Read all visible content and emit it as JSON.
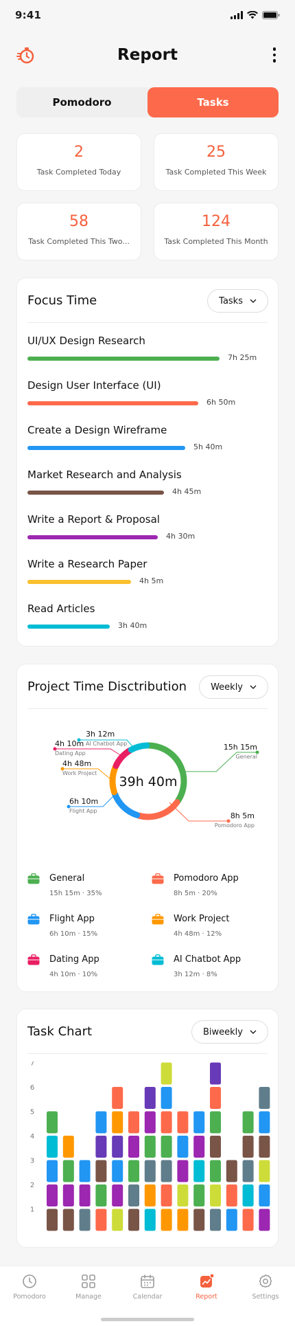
{
  "status": {
    "time": "9:41"
  },
  "header": {
    "title": "Report"
  },
  "segments": [
    {
      "label": "Pomodoro",
      "active": false
    },
    {
      "label": "Tasks",
      "active": true
    }
  ],
  "stats": [
    {
      "value": "2",
      "label": "Task Completed Today"
    },
    {
      "value": "25",
      "label": "Task Completed This Week"
    },
    {
      "value": "58",
      "label": "Task Completed This Two..."
    },
    {
      "value": "124",
      "label": "Task Completed This Month"
    }
  ],
  "focus": {
    "title": "Focus Time",
    "dropdown": "Tasks",
    "items": [
      {
        "name": "UI/UX Design Research",
        "time": "7h 25m",
        "color": "#4caf50",
        "fraction": 1.0
      },
      {
        "name": "Design User Interface (UI)",
        "time": "6h 50m",
        "color": "#fd6a4b",
        "fraction": 0.89
      },
      {
        "name": "Create a Design Wireframe",
        "time": "5h 40m",
        "color": "#2196f3",
        "fraction": 0.82
      },
      {
        "name": "Market Research and Analysis",
        "time": "4h 45m",
        "color": "#795548",
        "fraction": 0.71
      },
      {
        "name": "Write a Report & Proposal",
        "time": "4h 30m",
        "color": "#9c27b0",
        "fraction": 0.68
      },
      {
        "name": "Write a Research Paper",
        "time": "4h 5m",
        "color": "#fbc02d",
        "fraction": 0.54
      },
      {
        "name": "Read Articles",
        "time": "3h 40m",
        "color": "#00bcd4",
        "fraction": 0.43
      }
    ]
  },
  "distribution": {
    "title": "Project Time Disctribution",
    "dropdown": "Weekly",
    "total": "39h 40m",
    "segments": [
      {
        "name": "General",
        "time": "15h 15m",
        "percent": "35%",
        "pct": 35,
        "color": "#4caf50"
      },
      {
        "name": "Pomodoro App",
        "time": "8h 5m",
        "percent": "20%",
        "pct": 20,
        "color": "#fd6a4b"
      },
      {
        "name": "Flight App",
        "time": "6h 10m",
        "percent": "15%",
        "pct": 15,
        "color": "#2196f3"
      },
      {
        "name": "Work Project",
        "time": "4h 48m",
        "percent": "12%",
        "pct": 12,
        "color": "#ff9800"
      },
      {
        "name": "Dating App",
        "time": "4h 10m",
        "percent": "10%",
        "pct": 10,
        "color": "#e91e63"
      },
      {
        "name": "AI Chatbot App",
        "time": "3h 12m",
        "percent": "8%",
        "pct": 8,
        "color": "#00bcd4"
      }
    ],
    "legend_order": [
      "General",
      "Pomodoro App",
      "Flight App",
      "Work Project",
      "Dating App",
      "AI Chatbot App"
    ]
  },
  "task_chart": {
    "title": "Task Chart",
    "dropdown": "Biweekly",
    "y_ticks": [
      "7",
      "6",
      "5",
      "4",
      "3",
      "2",
      "1"
    ]
  },
  "chart_data": {
    "type": "bar",
    "title": "Task Chart",
    "ylim": [
      0,
      7
    ],
    "stacked": true,
    "columns": [
      [
        "#795548",
        "#9c27b0",
        "#2196f3",
        "#00bcd4",
        "#4caf50"
      ],
      [
        "#795548",
        "#9c27b0",
        "#4caf50",
        "#ff9800"
      ],
      [
        "#607d8b",
        "#9c27b0",
        "#2196f3"
      ],
      [
        "#fd6a4b",
        "#4caf50",
        "#795548",
        "#673ab7",
        "#2196f3"
      ],
      [
        "#cddc39",
        "#9c27b0",
        "#2196f3",
        "#673ab7",
        "#ff9800",
        "#fd6a4b"
      ],
      [
        "#795548",
        "#607d8b",
        "#4caf50",
        "#9c27b0",
        "#fd6a4b"
      ],
      [
        "#00bcd4",
        "#ff9800",
        "#607d8b",
        "#4caf50",
        "#9c27b0",
        "#673ab7"
      ],
      [
        "#ff9800",
        "#fd6a4b",
        "#607d8b",
        "#4caf50",
        "#fd6a4b",
        "#2196f3",
        "#cddc39"
      ],
      [
        "#ff9800",
        "#cddc39",
        "#9c27b0",
        "#2196f3",
        "#fd6a4b"
      ],
      [
        "#795548",
        "#4caf50",
        "#00bcd4",
        "#9c27b0",
        "#2196f3"
      ],
      [
        "#607d8b",
        "#cddc39",
        "#4caf50",
        "#795548",
        "#4caf50",
        "#fd6a4b",
        "#673ab7"
      ],
      [
        "#2196f3",
        "#fd6a4b",
        "#795548"
      ],
      [
        "#fd6a4b",
        "#00bcd4",
        "#607d8b",
        "#795548",
        "#4caf50"
      ],
      [
        "#9c27b0",
        "#2196f3",
        "#cddc39",
        "#795548",
        "#2196f3",
        "#607d8b"
      ]
    ]
  },
  "tabs": [
    {
      "label": "Pomodoro",
      "icon": "clock-icon",
      "active": false
    },
    {
      "label": "Manage",
      "icon": "grid-icon",
      "active": false
    },
    {
      "label": "Calendar",
      "icon": "calendar-icon",
      "active": false
    },
    {
      "label": "Report",
      "icon": "report-icon",
      "active": true
    },
    {
      "label": "Settings",
      "icon": "gear-icon",
      "active": false
    }
  ]
}
